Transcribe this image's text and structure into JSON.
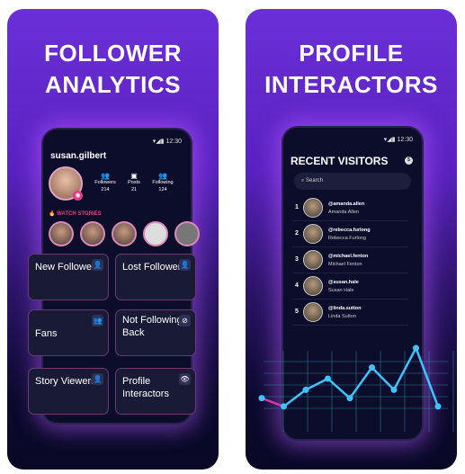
{
  "left": {
    "title_line1": "FOLLOWER",
    "title_line2": "ANALYTICS",
    "status_time": "12:30",
    "profile": {
      "username": "susan.gilbert",
      "stats": [
        {
          "label": "Followers",
          "value": "214"
        },
        {
          "label": "Posts",
          "value": "21"
        },
        {
          "label": "Following",
          "value": "124"
        }
      ]
    },
    "watch_stories": "WATCH STORIES",
    "cards": [
      {
        "label": "New Followers",
        "icon": "add-user-icon",
        "glyph": "👤"
      },
      {
        "label": "Lost Followers",
        "icon": "remove-user-icon",
        "glyph": "👤"
      },
      {
        "label": "Fans",
        "icon": "group-icon",
        "glyph": "👥"
      },
      {
        "label": "Not Following Back",
        "icon": "unfollow-icon",
        "glyph": "⊘"
      },
      {
        "label": "Story Viewers",
        "icon": "user-icon",
        "glyph": "👤"
      },
      {
        "label": "Profile Interactors",
        "icon": "eye-icon",
        "glyph": "👁"
      }
    ]
  },
  "right": {
    "title_line1": "PROFILE",
    "title_line2": "INTERACTORS",
    "status_time": "12:30",
    "header": "RECENT VISITORS",
    "search_placeholder": "Search",
    "visitors": [
      {
        "rank": "1",
        "handle": "@amanda.allen",
        "name": "Amanda Allen"
      },
      {
        "rank": "2",
        "handle": "@rebecca.furlong",
        "name": "Rebecca Furlong"
      },
      {
        "rank": "3",
        "handle": "@michael.fenton",
        "name": "Michael Fenton"
      },
      {
        "rank": "4",
        "handle": "@susan.hale",
        "name": "Susan Hale"
      },
      {
        "rank": "5",
        "handle": "@linda.sutton",
        "name": "Linda Sutton"
      }
    ],
    "trend_values": [
      4,
      1,
      7,
      11,
      4,
      15,
      7,
      22,
      1
    ],
    "line_color": "#3ec3ff",
    "accent_color": "#d63aa8"
  }
}
